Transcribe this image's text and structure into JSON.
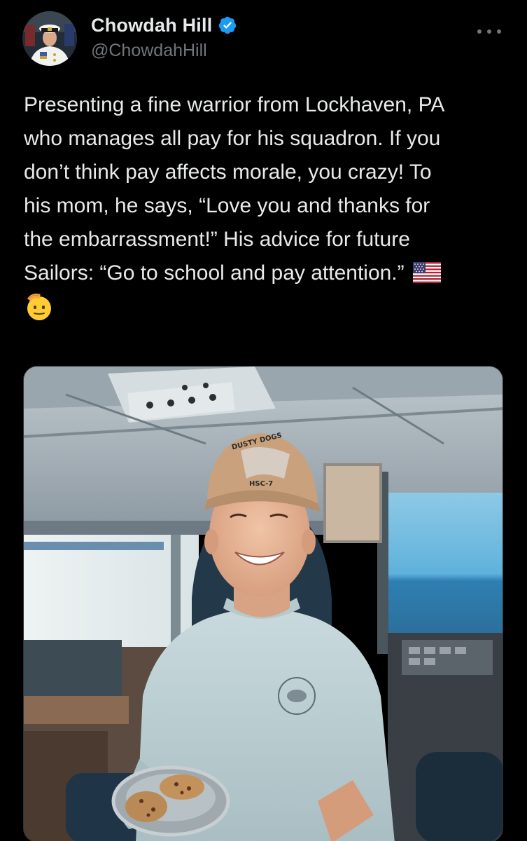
{
  "post": {
    "author": {
      "display_name": "Chowdah Hill",
      "handle": "@ChowdahHill",
      "verified": true,
      "verified_color": "#1d9bf0"
    },
    "more_icon": "more-horizontal-icon",
    "text": "Presenting a fine warrior from Lockhaven, PA\nwho manages all pay for his squadron. If you\ndon’t think pay affects morale, you crazy! To\nhis mom, he says, “Love you and thanks for\nthe embarrassment!” His advice for future\nSailors: “Go to school and pay attention.”",
    "trailing_emoji": [
      "us-flag-emoji",
      "saluting-face-emoji"
    ],
    "media": {
      "type": "photo",
      "cap_text_top": "DUSTY DOGS",
      "cap_text_bottom": "HSC-7"
    }
  },
  "colors": {
    "background": "#000000",
    "text_primary": "#e7e9ea",
    "text_secondary": "#71767b",
    "accent": "#1d9bf0"
  }
}
